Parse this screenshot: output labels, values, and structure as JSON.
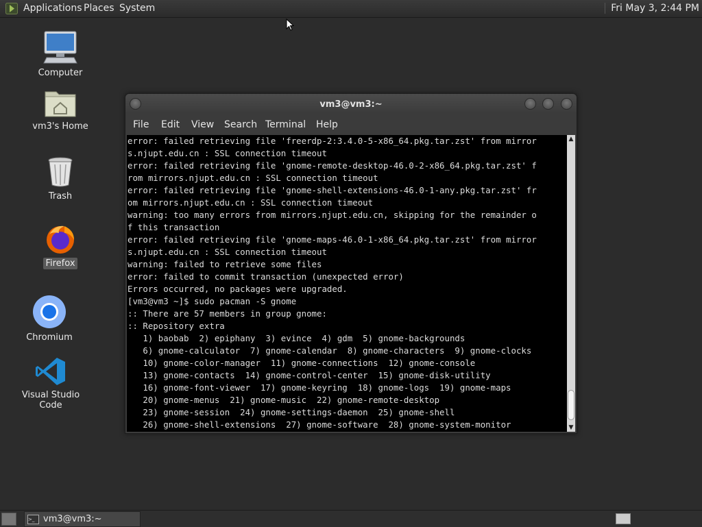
{
  "top_panel": {
    "menus": [
      "Applications",
      "Places",
      "System"
    ],
    "clock": "Fri May 3, 2:44 PM"
  },
  "desktop_icons": [
    {
      "label": "Computer",
      "icon": "computer-icon"
    },
    {
      "label": "vm3's Home",
      "icon": "home-folder-icon"
    },
    {
      "label": "Trash",
      "icon": "trash-icon"
    },
    {
      "label": "Firefox",
      "icon": "firefox-icon"
    },
    {
      "label": "Chromium",
      "icon": "chromium-icon"
    },
    {
      "label": "Visual Studio Code",
      "icon": "vscode-icon"
    }
  ],
  "window": {
    "title": "vm3@vm3:~",
    "menu": [
      "File",
      "Edit",
      "View",
      "Search",
      "Terminal",
      "Help"
    ]
  },
  "terminal": {
    "lines": [
      "error: failed retrieving file 'freerdp-2:3.4.0-5-x86_64.pkg.tar.zst' from mirror",
      "s.njupt.edu.cn : SSL connection timeout",
      "error: failed retrieving file 'gnome-remote-desktop-46.0-2-x86_64.pkg.tar.zst' f",
      "rom mirrors.njupt.edu.cn : SSL connection timeout",
      "error: failed retrieving file 'gnome-shell-extensions-46.0-1-any.pkg.tar.zst' fr",
      "om mirrors.njupt.edu.cn : SSL connection timeout",
      "warning: too many errors from mirrors.njupt.edu.cn, skipping for the remainder o",
      "f this transaction",
      "error: failed retrieving file 'gnome-maps-46.0-1-x86_64.pkg.tar.zst' from mirror",
      "s.njupt.edu.cn : SSL connection timeout",
      "warning: failed to retrieve some files",
      "error: failed to commit transaction (unexpected error)",
      "Errors occurred, no packages were upgraded.",
      "[vm3@vm3 ~]$ sudo pacman -S gnome",
      ":: There are 57 members in group gnome:",
      ":: Repository extra",
      "   1) baobab  2) epiphany  3) evince  4) gdm  5) gnome-backgrounds",
      "   6) gnome-calculator  7) gnome-calendar  8) gnome-characters  9) gnome-clocks",
      "   10) gnome-color-manager  11) gnome-connections  12) gnome-console",
      "   13) gnome-contacts  14) gnome-control-center  15) gnome-disk-utility",
      "   16) gnome-font-viewer  17) gnome-keyring  18) gnome-logs  19) gnome-maps",
      "   20) gnome-menus  21) gnome-music  22) gnome-remote-desktop",
      "   23) gnome-session  24) gnome-settings-daemon  25) gnome-shell",
      "   26) gnome-shell-extensions  27) gnome-software  28) gnome-system-monitor"
    ]
  },
  "taskbar": {
    "window_label": "vm3@vm3:~"
  }
}
